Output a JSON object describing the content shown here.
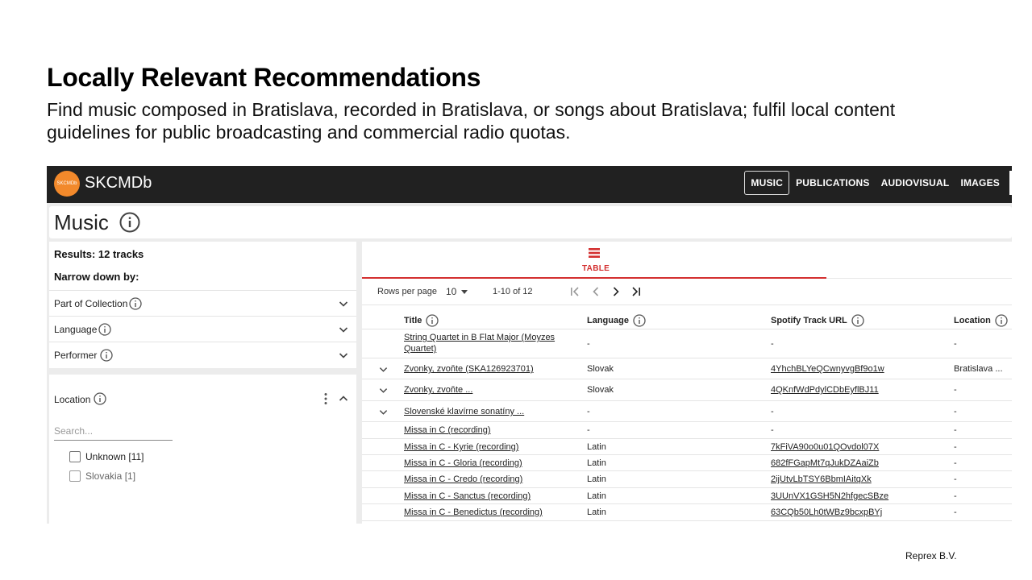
{
  "slide": {
    "title": "Locally Relevant Recommendations",
    "subtitle": "Find music composed in Bratislava, recorded in Bratislava, or songs about Bratislava; fulfil local content guidelines for public broadcasting and commercial radio quotas.",
    "footer": "Reprex B.V."
  },
  "app": {
    "logo_text": "SKCMDb",
    "brand": "SKCMDb",
    "nav": [
      "MUSIC",
      "PUBLICATIONS",
      "AUDIOVISUAL",
      "IMAGES"
    ],
    "page_title": "Music"
  },
  "filters": {
    "results": "Results: 12 tracks",
    "narrow": "Narrow down by:",
    "facets": [
      "Part of Collection",
      "Language",
      "Performer"
    ],
    "location": {
      "label": "Location",
      "search_placeholder": "Search...",
      "options": [
        "Unknown [11]",
        "Slovakia [1]"
      ]
    }
  },
  "table": {
    "tab_label": "TABLE",
    "rows_per_page_label": "Rows per page",
    "rows_per_page": "10",
    "range": "1-10 of 12",
    "columns": [
      "Title",
      "Language",
      "Spotify Track URL",
      "Location"
    ],
    "rows": [
      {
        "title": "String Quartet in B Flat Major (Moyzes Quartet)",
        "language": "-",
        "spotify": "-",
        "location": "-"
      },
      {
        "title": "Zvonky, zvoňte (SKA126923701)",
        "language": "Slovak",
        "spotify": "4YhchBLYeQCwnyvgBf9o1w",
        "location": "Bratislava ..."
      },
      {
        "title": "Zvonky, zvoňte ...",
        "language": "Slovak",
        "spotify": "4QKnfWdPdylCDbEyflBJ11",
        "location": "-"
      },
      {
        "title": "Slovenské klavírne sonatíny ...",
        "language": "-",
        "spotify": "-",
        "location": "-"
      },
      {
        "title": "Missa in C (recording)",
        "language": "-",
        "spotify": "-",
        "location": "-"
      },
      {
        "title": "Missa in C - Kyrie (recording)",
        "language": "Latin",
        "spotify": "7kFiVA90o0u01QOvdol07X",
        "location": "-"
      },
      {
        "title": "Missa in C - Gloria (recording)",
        "language": "Latin",
        "spotify": "682fFGapMt7qJukDZAaiZb",
        "location": "-"
      },
      {
        "title": "Missa in C - Credo (recording)",
        "language": "Latin",
        "spotify": "2ijUtvLbTSY6BbmIAitqXk",
        "location": "-"
      },
      {
        "title": "Missa in C - Sanctus (recording)",
        "language": "Latin",
        "spotify": "3UUnVX1GSH5N2hfgecSBze",
        "location": "-"
      },
      {
        "title": "Missa in C - Benedictus (recording)",
        "language": "Latin",
        "spotify": "63CQb50Lh0tWBz9bcxpBYj",
        "location": "-"
      }
    ]
  },
  "colors": {
    "topbar": "#212121",
    "logo": "#f2892b",
    "accent": "#d32f2f"
  }
}
